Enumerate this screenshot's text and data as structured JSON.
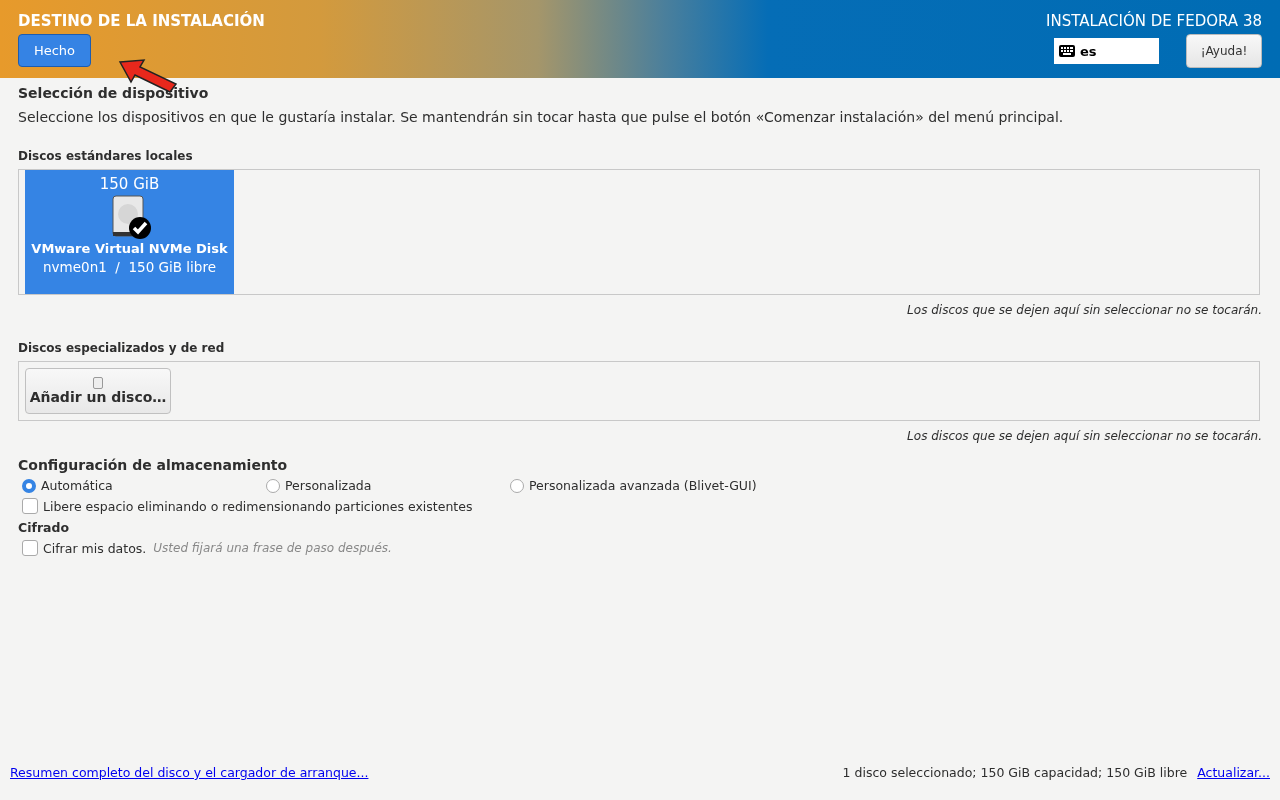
{
  "header": {
    "title": "DESTINO DE LA INSTALACIÓN",
    "done_button": "Hecho",
    "product": "INSTALACIÓN DE FEDORA 38",
    "keyboard_layout": "es",
    "help_button": "¡Ayuda!"
  },
  "device_selection": {
    "heading": "Selección de dispositivo",
    "description": "Seleccione los dispositivos en que le gustaría instalar. Se mantendrán sin tocar hasta que pulse el botón «Comenzar instalación» del menú principal."
  },
  "local_disks": {
    "heading": "Discos estándares locales",
    "disks": [
      {
        "size": "150 GiB",
        "name": "VMware Virtual NVMe Disk",
        "info": "nvme0n1  /  150 GiB libre",
        "selected": true
      }
    ],
    "note": "Los discos que se dejen aquí sin seleccionar no se tocarán."
  },
  "specialized_disks": {
    "heading": "Discos especializados y de red",
    "add_button": "Añadir un disco…",
    "note": "Los discos que se dejen aquí sin seleccionar no se tocarán."
  },
  "storage": {
    "heading": "Configuración de almacenamiento",
    "options": [
      {
        "label": "Automática",
        "selected": true
      },
      {
        "label": "Personalizada",
        "selected": false
      },
      {
        "label": "Personalizada avanzada (Blivet-GUI)",
        "selected": false
      }
    ],
    "reclaim": {
      "label": "Libere espacio eliminando o redimensionando particiones existentes",
      "checked": false
    }
  },
  "encryption": {
    "heading": "Cifrado",
    "encrypt": {
      "label": "Cifrar mis datos.",
      "hint": "Usted fijará una frase de paso después.",
      "checked": false
    }
  },
  "footer": {
    "summary_link": "Resumen completo del disco y el cargador de arranque...",
    "status": "1 disco seleccionado; 150 GiB capacidad; 150 GiB libre",
    "refresh_link": "Actualizar..."
  }
}
